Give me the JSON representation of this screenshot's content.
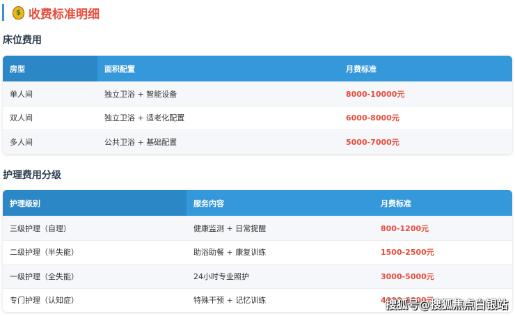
{
  "title": {
    "icon": "money-bag-icon",
    "text": "收费标准明细"
  },
  "bed": {
    "heading": "床位费用",
    "headers": [
      "房型",
      "面积配置",
      "月费标准"
    ],
    "rows": [
      [
        "单人间",
        "独立卫浴 + 智能设备",
        "8000-10000元"
      ],
      [
        "双人间",
        "独立卫浴 + 适老化配置",
        "6000-8000元"
      ],
      [
        "多人间",
        "公共卫浴 + 基础配置",
        "5000-7000元"
      ]
    ]
  },
  "care": {
    "heading": "护理费用分级",
    "headers": [
      "护理级别",
      "服务内容",
      "月费标准"
    ],
    "rows": [
      [
        "三级护理（自理）",
        "健康监测 + 日常提醒",
        "800-1200元"
      ],
      [
        "二级护理（半失能）",
        "助浴助餐 + 康复训练",
        "1500-2500元"
      ],
      [
        "一级护理（全失能）",
        "24小时专业照护",
        "3000-5000元"
      ],
      [
        "专门护理（认知症）",
        "特殊干预 + 记忆训练",
        "4000-6000元"
      ]
    ]
  },
  "watermark": "搜狐号@搜狐焦点白银站"
}
